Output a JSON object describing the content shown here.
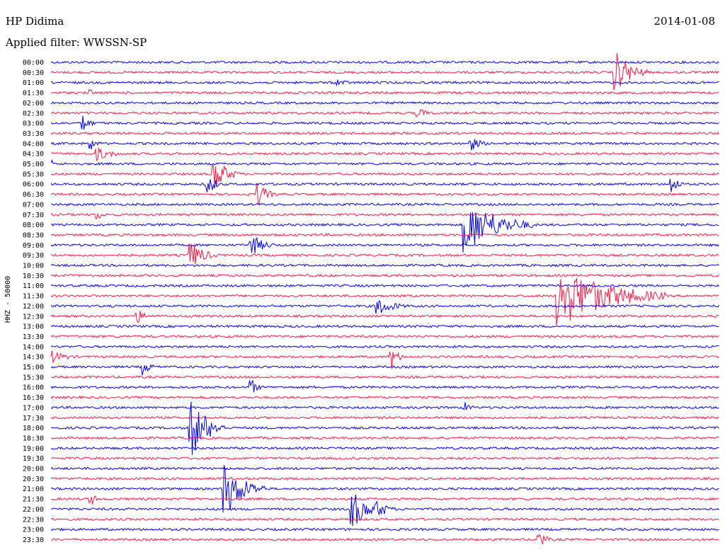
{
  "header": {
    "station": "HP Didima",
    "date": "2014-01-08",
    "filter_label": "Applied filter: WWSSN-SP"
  },
  "chart_data": {
    "type": "helicorder",
    "ylabel": "HHZ - 50000",
    "colors": [
      "#0000ee",
      "#ff1744"
    ],
    "rows": [
      "00:00",
      "00:30",
      "01:00",
      "01:30",
      "02:00",
      "02:30",
      "03:00",
      "03:30",
      "04:00",
      "04:30",
      "05:00",
      "05:30",
      "06:00",
      "06:30",
      "07:00",
      "07:30",
      "08:00",
      "08:30",
      "09:00",
      "09:30",
      "10:00",
      "10:30",
      "11:00",
      "11:30",
      "12:00",
      "12:30",
      "13:00",
      "13:30",
      "14:00",
      "14:30",
      "15:00",
      "15:30",
      "16:00",
      "16:30",
      "17:00",
      "17:30",
      "18:00",
      "18:30",
      "19:00",
      "19:30",
      "20:00",
      "20:30",
      "21:00",
      "21:30",
      "22:00",
      "22:30",
      "23:00",
      "23:30"
    ],
    "events": [
      {
        "row": 1,
        "t": 0.845,
        "amp": 30,
        "dur": 0.05
      },
      {
        "row": 2,
        "t": 0.43,
        "amp": 6,
        "dur": 0.03
      },
      {
        "row": 3,
        "t": 0.06,
        "amp": 5,
        "dur": 0.01
      },
      {
        "row": 5,
        "t": 0.55,
        "amp": 7,
        "dur": 0.04
      },
      {
        "row": 6,
        "t": 0.05,
        "amp": 12,
        "dur": 0.02
      },
      {
        "row": 8,
        "t": 0.06,
        "amp": 10,
        "dur": 0.02
      },
      {
        "row": 8,
        "t": 0.63,
        "amp": 10,
        "dur": 0.03
      },
      {
        "row": 9,
        "t": 0.07,
        "amp": 10,
        "dur": 0.05
      },
      {
        "row": 10,
        "t": 0.0,
        "amp": 8,
        "dur": 0.01
      },
      {
        "row": 11,
        "t": 0.245,
        "amp": 26,
        "dur": 0.04
      },
      {
        "row": 12,
        "t": 0.235,
        "amp": 20,
        "dur": 0.02
      },
      {
        "row": 12,
        "t": 0.93,
        "amp": 14,
        "dur": 0.02
      },
      {
        "row": 13,
        "t": 0.31,
        "amp": 18,
        "dur": 0.03
      },
      {
        "row": 15,
        "t": 0.07,
        "amp": 8,
        "dur": 0.02
      },
      {
        "row": 16,
        "t": 0.62,
        "amp": 40,
        "dur": 0.1
      },
      {
        "row": 18,
        "t": 0.3,
        "amp": 16,
        "dur": 0.04
      },
      {
        "row": 19,
        "t": 0.21,
        "amp": 22,
        "dur": 0.04
      },
      {
        "row": 23,
        "t": 0.76,
        "amp": 45,
        "dur": 0.16
      },
      {
        "row": 24,
        "t": 0.49,
        "amp": 14,
        "dur": 0.05
      },
      {
        "row": 25,
        "t": 0.13,
        "amp": 10,
        "dur": 0.03
      },
      {
        "row": 29,
        "t": 0.0,
        "amp": 10,
        "dur": 0.05
      },
      {
        "row": 29,
        "t": 0.51,
        "amp": 18,
        "dur": 0.02
      },
      {
        "row": 30,
        "t": 0.14,
        "amp": 12,
        "dur": 0.02
      },
      {
        "row": 32,
        "t": 0.3,
        "amp": 12,
        "dur": 0.02
      },
      {
        "row": 34,
        "t": 0.62,
        "amp": 8,
        "dur": 0.02
      },
      {
        "row": 36,
        "t": 0.21,
        "amp": 45,
        "dur": 0.05
      },
      {
        "row": 42,
        "t": 0.26,
        "amp": 40,
        "dur": 0.06
      },
      {
        "row": 43,
        "t": 0.06,
        "amp": 10,
        "dur": 0.02
      },
      {
        "row": 44,
        "t": 0.45,
        "amp": 30,
        "dur": 0.05
      },
      {
        "row": 44,
        "t": 0.49,
        "amp": 14,
        "dur": 0.03
      },
      {
        "row": 47,
        "t": 0.73,
        "amp": 16,
        "dur": 0.02
      }
    ]
  }
}
